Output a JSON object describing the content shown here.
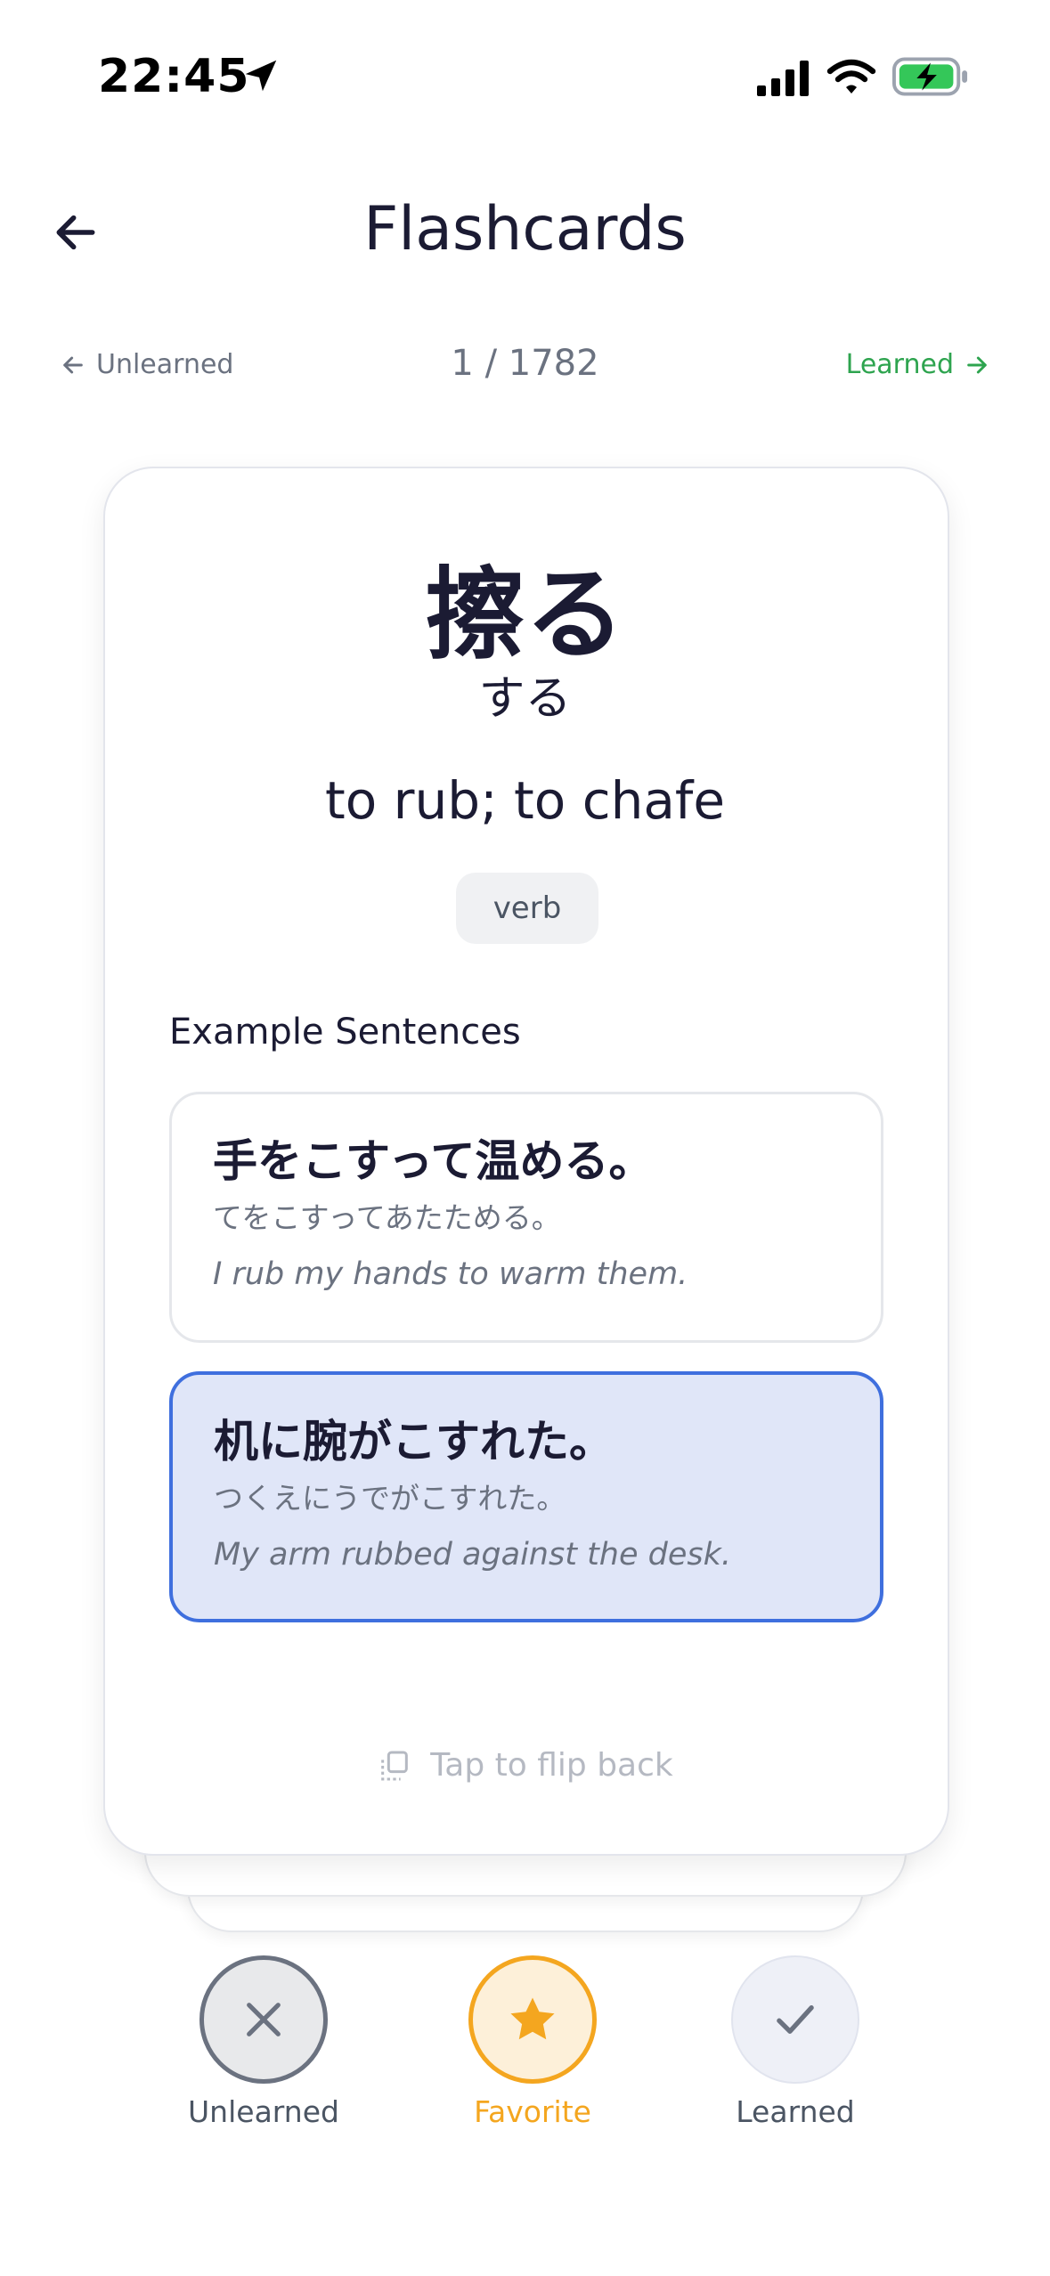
{
  "status_bar": {
    "time": "22:45"
  },
  "header": {
    "title": "Flashcards"
  },
  "nav": {
    "prev_label": "Unlearned",
    "counter": "1 / 1782",
    "next_label": "Learned"
  },
  "card": {
    "kanji": "擦る",
    "reading": "する",
    "meaning": "to rub; to chafe",
    "part_of_speech": "verb",
    "examples_heading": "Example Sentences",
    "examples": [
      {
        "japanese": "手をこすって温める。",
        "kana": "てをこすってあたためる。",
        "english": "I rub my hands to warm them."
      },
      {
        "japanese": "机に腕がこすれた。",
        "kana": "つくえにうでがこすれた。",
        "english": "My arm rubbed against the desk."
      }
    ],
    "flip_hint": "Tap to flip back"
  },
  "actions": {
    "unlearned_label": "Unlearned",
    "favorite_label": "Favorite",
    "learned_label": "Learned"
  },
  "colors": {
    "accent_green": "#2ea44f",
    "accent_orange": "#f4a61f",
    "accent_blue": "#3f6fde",
    "text_primary": "#1b1b33",
    "text_muted": "#6b7280"
  }
}
